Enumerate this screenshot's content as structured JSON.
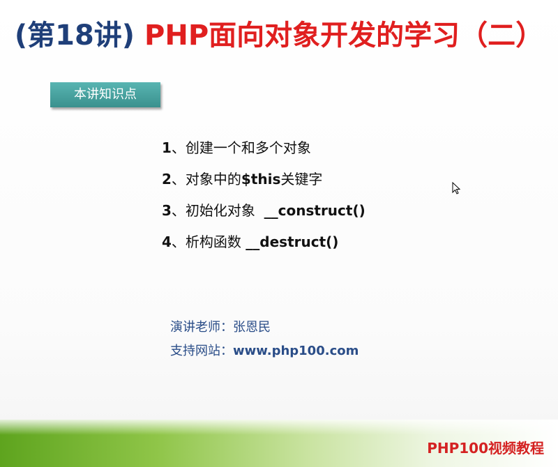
{
  "title": {
    "lecture": "(第18讲)",
    "subject": "PHP面向对象开发的学习（二）"
  },
  "tag": "本讲知识点",
  "points": [
    {
      "num": "1",
      "sep": "、",
      "text": "创建一个和多个对象",
      "code": ""
    },
    {
      "num": "2",
      "sep": "、",
      "text": "对象中的",
      "code": "$this",
      "after": "关键字"
    },
    {
      "num": "3",
      "sep": "、",
      "text": "初始化对象  ",
      "code": "__construct()"
    },
    {
      "num": "4",
      "sep": "、",
      "text": "析构函数 ",
      "code": "__destruct()"
    }
  ],
  "credits": {
    "teacher_label": "演讲老师：",
    "teacher": "张恩民",
    "site_label": "支持网站：",
    "site": "www.php100.com"
  },
  "brand": {
    "name": "PHP100",
    "suffix": "视频教程"
  },
  "colors": {
    "title_lecture": "#1f3f79",
    "title_subject": "#e01f1f",
    "tag_bg": "#4aa6a3",
    "credits": "#2a4d88",
    "brand": "#d42222"
  },
  "icons": [
    "mouse-cursor-icon"
  ]
}
